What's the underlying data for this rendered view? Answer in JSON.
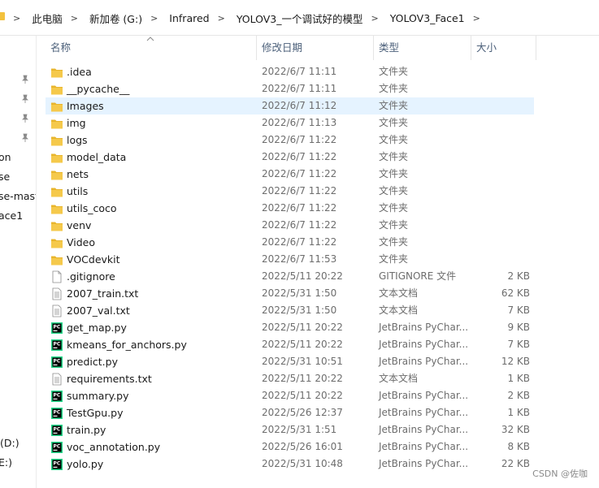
{
  "breadcrumb": [
    "此电脑",
    "新加卷 (G:)",
    "Infrared",
    "YOLOV3_一个调试好的模型",
    "YOLOV3_Face1"
  ],
  "columns": {
    "name": "名称",
    "date": "修改日期",
    "type": "类型",
    "size": "大小"
  },
  "nav": {
    "items": [
      "on",
      "se",
      "se-mast",
      "ace1"
    ],
    "drives": [
      "(D:)",
      "E:)"
    ]
  },
  "files": [
    {
      "name": ".idea",
      "date": "2022/6/7 11:11",
      "type": "文件夹",
      "size": "",
      "icon": "folder"
    },
    {
      "name": "__pycache__",
      "date": "2022/6/7 11:11",
      "type": "文件夹",
      "size": "",
      "icon": "folder"
    },
    {
      "name": "Images",
      "date": "2022/6/7 11:12",
      "type": "文件夹",
      "size": "",
      "icon": "folder",
      "selected": true
    },
    {
      "name": "img",
      "date": "2022/6/7 11:13",
      "type": "文件夹",
      "size": "",
      "icon": "folder"
    },
    {
      "name": "logs",
      "date": "2022/6/7 11:22",
      "type": "文件夹",
      "size": "",
      "icon": "folder"
    },
    {
      "name": "model_data",
      "date": "2022/6/7 11:22",
      "type": "文件夹",
      "size": "",
      "icon": "folder"
    },
    {
      "name": "nets",
      "date": "2022/6/7 11:22",
      "type": "文件夹",
      "size": "",
      "icon": "folder"
    },
    {
      "name": "utils",
      "date": "2022/6/7 11:22",
      "type": "文件夹",
      "size": "",
      "icon": "folder"
    },
    {
      "name": "utils_coco",
      "date": "2022/6/7 11:22",
      "type": "文件夹",
      "size": "",
      "icon": "folder"
    },
    {
      "name": "venv",
      "date": "2022/6/7 11:22",
      "type": "文件夹",
      "size": "",
      "icon": "folder"
    },
    {
      "name": "Video",
      "date": "2022/6/7 11:22",
      "type": "文件夹",
      "size": "",
      "icon": "folder"
    },
    {
      "name": "VOCdevkit",
      "date": "2022/6/7 11:53",
      "type": "文件夹",
      "size": "",
      "icon": "folder"
    },
    {
      "name": ".gitignore",
      "date": "2022/5/11 20:22",
      "type": "GITIGNORE 文件",
      "size": "2 KB",
      "icon": "blank"
    },
    {
      "name": "2007_train.txt",
      "date": "2022/5/31 1:50",
      "type": "文本文档",
      "size": "62 KB",
      "icon": "text"
    },
    {
      "name": "2007_val.txt",
      "date": "2022/5/31 1:50",
      "type": "文本文档",
      "size": "7 KB",
      "icon": "text"
    },
    {
      "name": "get_map.py",
      "date": "2022/5/11 20:22",
      "type": "JetBrains PyChar...",
      "size": "9 KB",
      "icon": "pycharm"
    },
    {
      "name": "kmeans_for_anchors.py",
      "date": "2022/5/11 20:22",
      "type": "JetBrains PyChar...",
      "size": "7 KB",
      "icon": "pycharm"
    },
    {
      "name": "predict.py",
      "date": "2022/5/31 10:51",
      "type": "JetBrains PyChar...",
      "size": "12 KB",
      "icon": "pycharm"
    },
    {
      "name": "requirements.txt",
      "date": "2022/5/11 20:22",
      "type": "文本文档",
      "size": "1 KB",
      "icon": "text"
    },
    {
      "name": "summary.py",
      "date": "2022/5/11 20:22",
      "type": "JetBrains PyChar...",
      "size": "2 KB",
      "icon": "pycharm"
    },
    {
      "name": "TestGpu.py",
      "date": "2022/5/26 12:37",
      "type": "JetBrains PyChar...",
      "size": "1 KB",
      "icon": "pycharm"
    },
    {
      "name": "train.py",
      "date": "2022/5/31 1:51",
      "type": "JetBrains PyChar...",
      "size": "32 KB",
      "icon": "pycharm"
    },
    {
      "name": "voc_annotation.py",
      "date": "2022/5/26 16:01",
      "type": "JetBrains PyChar...",
      "size": "8 KB",
      "icon": "pycharm"
    },
    {
      "name": "yolo.py",
      "date": "2022/5/31 10:48",
      "type": "JetBrains PyChar...",
      "size": "22 KB",
      "icon": "pycharm"
    }
  ],
  "watermark": "CSDN @佐咖",
  "colors": {
    "folder": "#f3c23e",
    "selection": "#e5f3ff",
    "header_text": "#4c607a"
  }
}
